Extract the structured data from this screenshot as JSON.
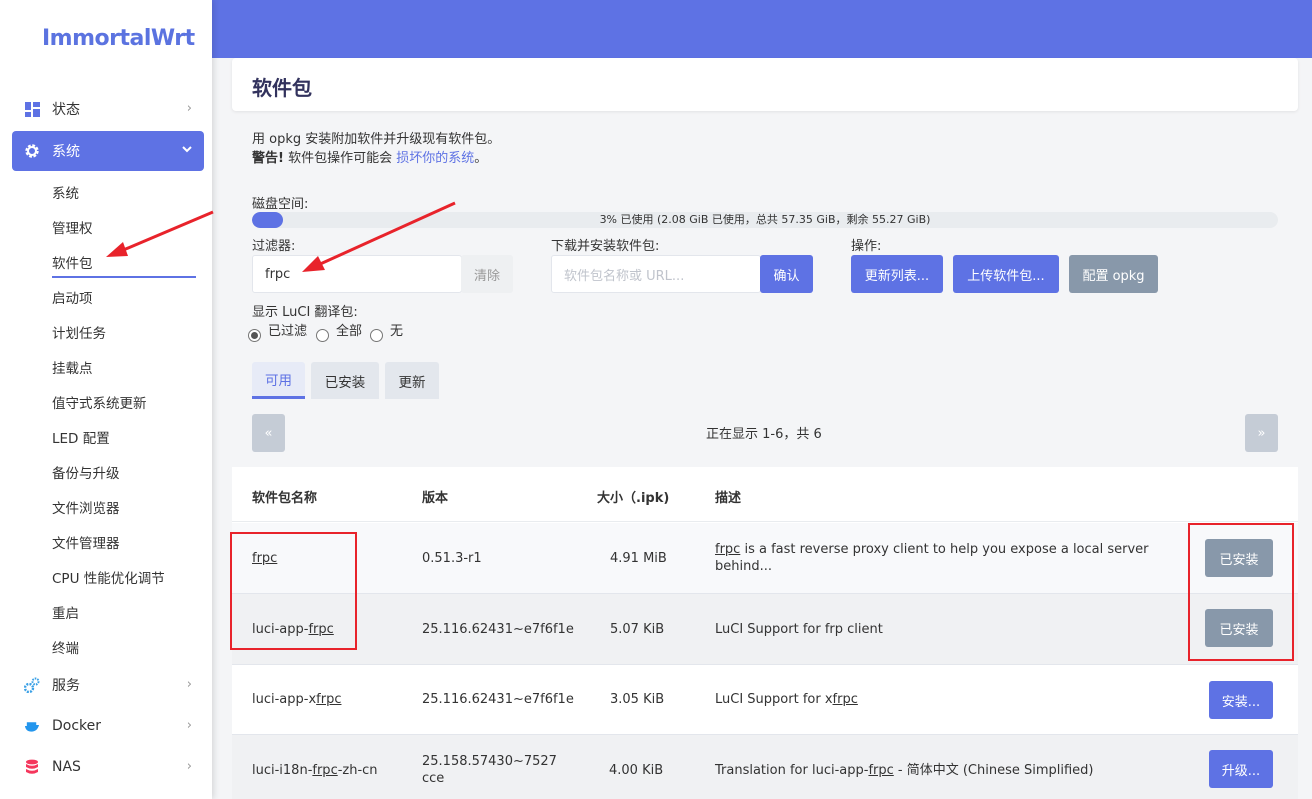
{
  "app": {
    "logo": "ImmortalWrt"
  },
  "sidebar": {
    "items": [
      {
        "label": "状态",
        "icon": "dashboard-icon"
      },
      {
        "label": "系统",
        "icon": "gear-icon"
      },
      {
        "label": "服务",
        "icon": "services-icon"
      },
      {
        "label": "Docker",
        "icon": "docker-icon"
      },
      {
        "label": "NAS",
        "icon": "database-icon"
      }
    ],
    "sub_items": [
      "系统",
      "管理权",
      "软件包",
      "启动项",
      "计划任务",
      "挂载点",
      "值守式系统更新",
      "LED 配置",
      "备份与升级",
      "文件浏览器",
      "文件管理器",
      "CPU 性能优化调节",
      "重启",
      "终端"
    ]
  },
  "page": {
    "title": "软件包",
    "desc_line1": "用 opkg 安装附加软件并升级现有软件包。",
    "warning_label": "警告!",
    "warning_text": "软件包操作可能会",
    "warning_link": "损坏你的系统",
    "warning_end": "。"
  },
  "disk": {
    "label": "磁盘空间:",
    "usage_text": "3% 已使用 (2.08 GiB 已使用，总共 57.35 GiB，剩余 55.27 GiB)",
    "used_fraction": 0.03
  },
  "filter": {
    "label": "过滤器:",
    "value": "frpc",
    "clear_label": "清除"
  },
  "download": {
    "label": "下载并安装软件包:",
    "placeholder": "软件包名称或 URL...",
    "ok_label": "确认"
  },
  "actions": {
    "label": "操作:",
    "update_lists": "更新列表...",
    "upload": "上传软件包...",
    "configure": "配置 opkg"
  },
  "translations": {
    "label": "显示 LuCI 翻译包:",
    "options": [
      "已过滤",
      "全部",
      "无"
    ],
    "selected": "已过滤"
  },
  "tabs": [
    {
      "label": "可用",
      "active": true
    },
    {
      "label": "已安装",
      "active": false
    },
    {
      "label": "更新",
      "active": false
    }
  ],
  "pager": {
    "prev": "«",
    "next": "»",
    "status": "正在显示 1-6，共 6"
  },
  "table": {
    "headers": [
      "软件包名称",
      "版本",
      "大小（.ipk)",
      "描述"
    ],
    "rows": [
      {
        "name_pre": "",
        "name_u": "frpc",
        "name_post": "",
        "version": "0.51.3-r1",
        "size": "4.91 MiB",
        "desc_pre": "",
        "desc_u": "frpc",
        "desc_post": " is a fast reverse proxy client to help you expose a local server behind...",
        "action": "已安装"
      },
      {
        "name_pre": "luci-app-",
        "name_u": "frpc",
        "name_post": "",
        "version": "25.116.62431~e7f6f1e",
        "size": "5.07 KiB",
        "desc_pre": "LuCI Support for frp client",
        "desc_u": "",
        "desc_post": "",
        "action": "已安装"
      },
      {
        "name_pre": "luci-app-x",
        "name_u": "frpc",
        "name_post": "",
        "version": "25.116.62431~e7f6f1e",
        "size": "3.05 KiB",
        "desc_pre": "LuCI Support for x",
        "desc_u": "frpc",
        "desc_post": "",
        "action": "安装..."
      },
      {
        "name_pre": "luci-i18n-",
        "name_u": "frpc",
        "name_post": "-zh-cn",
        "version": "25.158.57430~7527cce",
        "size": "4.00 KiB",
        "desc_pre": "Translation for luci-app-",
        "desc_u": "frpc",
        "desc_post": " - 简体中文 (Chinese Simplified)",
        "action": "升级..."
      }
    ]
  }
}
